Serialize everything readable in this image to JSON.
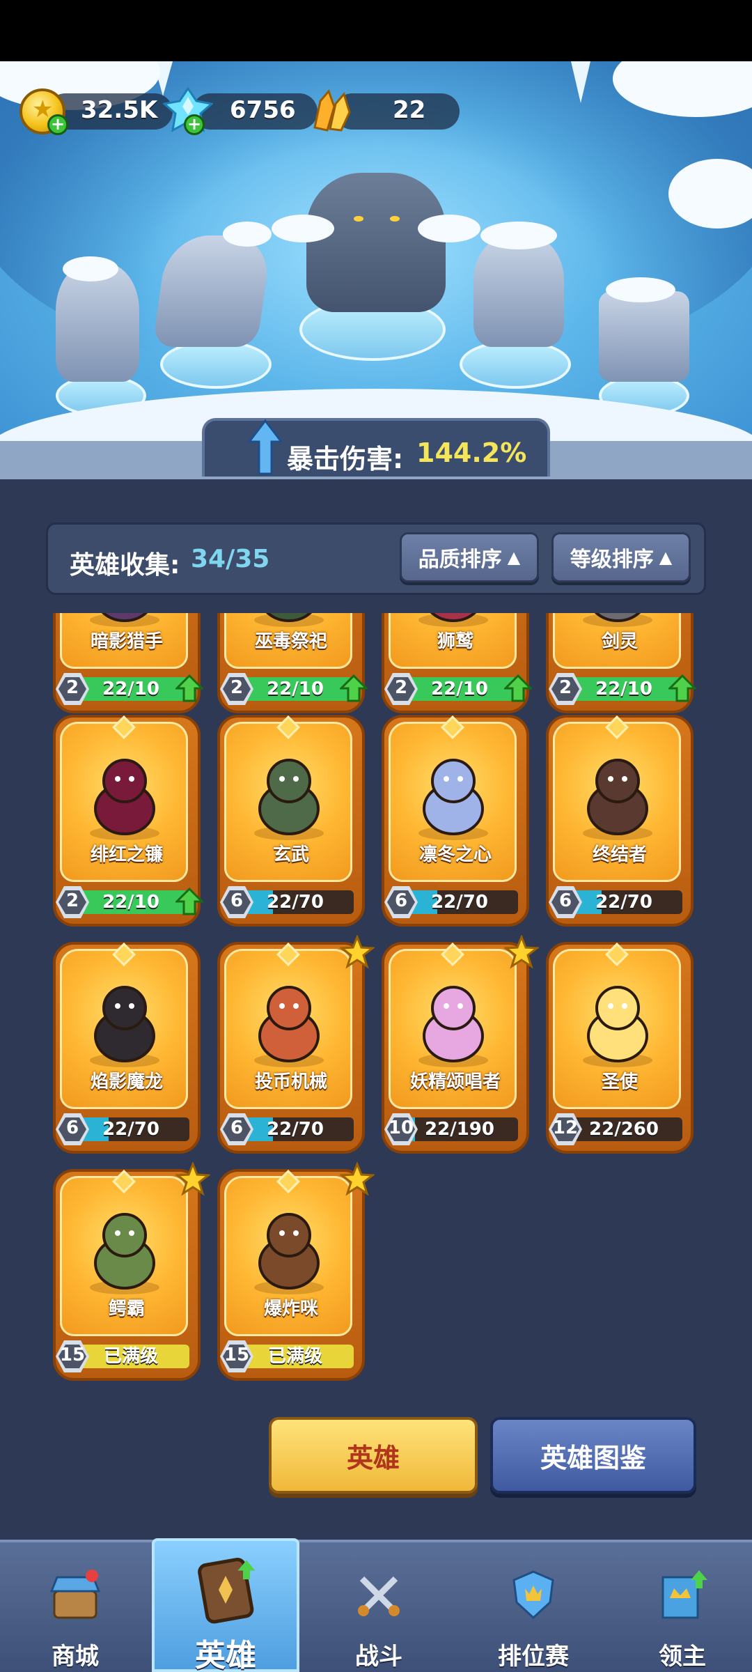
{
  "resources": {
    "gold": "32.5K",
    "gems": "6756",
    "crystals": "22"
  },
  "banner": {
    "label": "暴击伤害:",
    "value": "144.2%"
  },
  "collection": {
    "label": "英雄收集:",
    "value": "34/35",
    "sort_quality": "品质排序",
    "sort_level": "等级排序"
  },
  "heroes": [
    {
      "name": "暗影猎手",
      "level": "2",
      "progress": "22/10",
      "upgradable": true
    },
    {
      "name": "巫毒祭祀",
      "level": "2",
      "progress": "22/10",
      "upgradable": true
    },
    {
      "name": "狮鹫",
      "level": "2",
      "progress": "22/10",
      "upgradable": true
    },
    {
      "name": "剑灵",
      "level": "2",
      "progress": "22/10",
      "upgradable": true
    },
    {
      "name": "绯红之镰",
      "level": "2",
      "progress": "22/10",
      "upgradable": true
    },
    {
      "name": "玄武",
      "level": "6",
      "progress": "22/70",
      "fill": 0.31
    },
    {
      "name": "凛冬之心",
      "level": "6",
      "progress": "22/70",
      "fill": 0.31
    },
    {
      "name": "终结者",
      "level": "6",
      "progress": "22/70",
      "fill": 0.31
    },
    {
      "name": "焰影魔龙",
      "level": "6",
      "progress": "22/70",
      "fill": 0.31
    },
    {
      "name": "投币机械",
      "level": "6",
      "progress": "22/70",
      "fill": 0.31,
      "star": true
    },
    {
      "name": "妖精颂唱者",
      "level": "10",
      "progress": "22/190",
      "fill": 0.12,
      "star": true
    },
    {
      "name": "圣使",
      "level": "12",
      "progress": "22/260",
      "fill": 0.08
    },
    {
      "name": "鳄霸",
      "level": "15",
      "progress": "已满级",
      "max": true,
      "star": true
    },
    {
      "name": "爆炸咪",
      "level": "15",
      "progress": "已满级",
      "max": true,
      "star": true
    }
  ],
  "buttons": {
    "hero": "英雄",
    "hero_book": "英雄图鉴"
  },
  "nav": {
    "shop": "商城",
    "hero": "英雄",
    "battle": "战斗",
    "ranked": "排位赛",
    "lord": "领主"
  },
  "colors": {
    "upgrade_fill": "#38c95a",
    "progress_fill": "#2bb3d6",
    "max_fill": "#e8d53a",
    "accent_value": "#f5e55a"
  }
}
